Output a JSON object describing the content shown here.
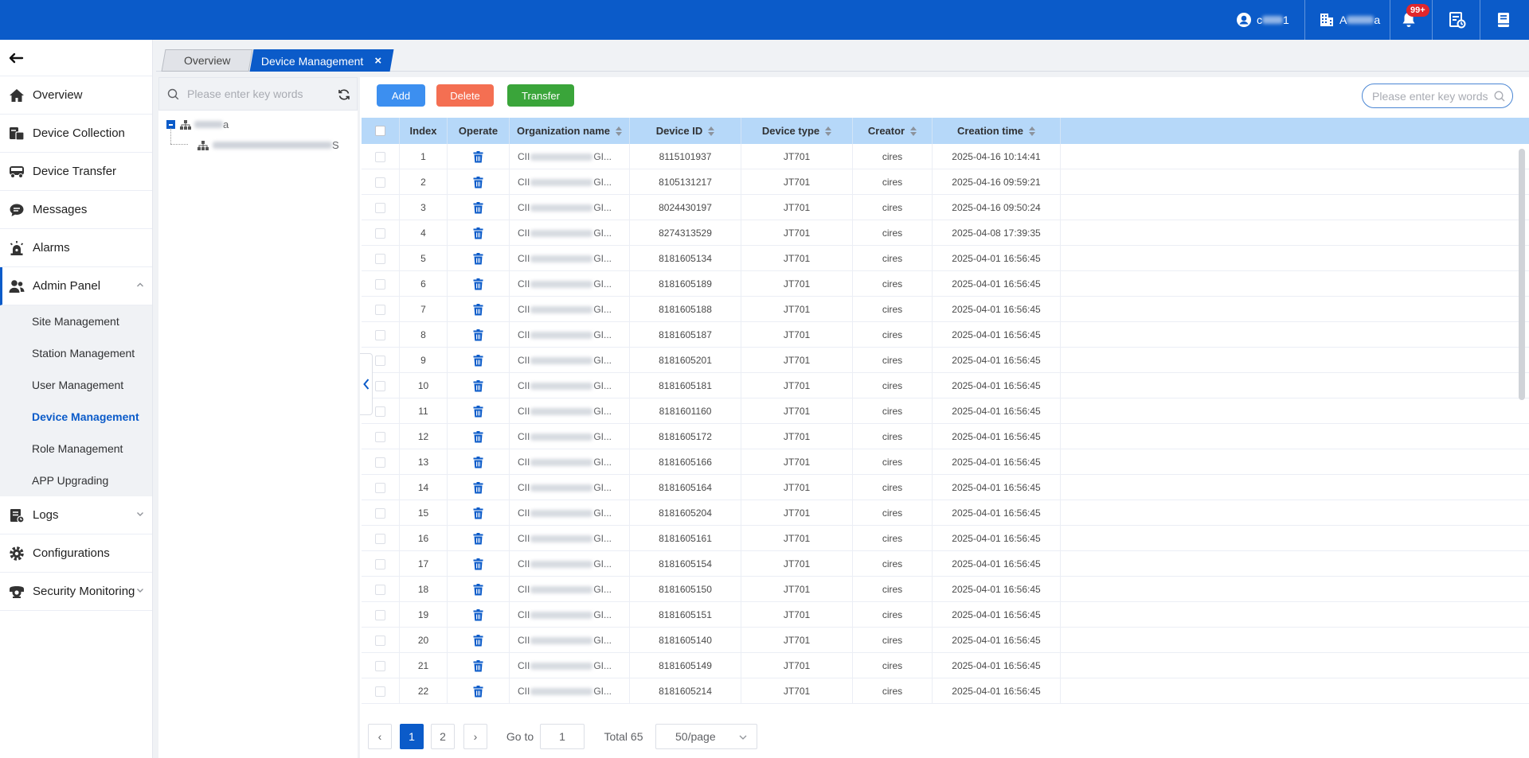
{
  "header": {
    "user_prefix": "c",
    "user_suffix": "1",
    "org_prefix": "A",
    "org_suffix": "a",
    "notification_badge": "99+",
    "icons": [
      "user-circle-icon",
      "building-icon",
      "bell-icon",
      "report-icon",
      "book-icon"
    ]
  },
  "sidebar": {
    "items": [
      {
        "label": "Overview",
        "icon": "home-icon"
      },
      {
        "label": "Device Collection",
        "icon": "device-collection-icon"
      },
      {
        "label": "Device Transfer",
        "icon": "truck-icon"
      },
      {
        "label": "Messages",
        "icon": "chat-icon"
      },
      {
        "label": "Alarms",
        "icon": "alarm-icon"
      },
      {
        "label": "Admin Panel",
        "icon": "users-icon"
      },
      {
        "label": "Logs",
        "icon": "logs-icon"
      },
      {
        "label": "Configurations",
        "icon": "gear-icon"
      },
      {
        "label": "Security Monitoring",
        "icon": "camera-icon"
      }
    ],
    "admin_sub": [
      {
        "label": "Site Management"
      },
      {
        "label": "Station Management"
      },
      {
        "label": "User Management"
      },
      {
        "label": "Device Management"
      },
      {
        "label": "Role Management"
      },
      {
        "label": "APP Upgrading"
      }
    ]
  },
  "tabs": [
    {
      "label": "Overview"
    },
    {
      "label": "Device Management",
      "close": "×"
    }
  ],
  "tree": {
    "search_placeholder": "Please enter key words",
    "root_suffix": "a",
    "child_suffix": "S"
  },
  "toolbar": {
    "add": "Add",
    "delete": "Delete",
    "transfer": "Transfer",
    "search_placeholder": "Please enter key words"
  },
  "table": {
    "columns": [
      "Index",
      "Operate",
      "Organization name",
      "Device ID",
      "Device type",
      "Creator",
      "Creation time"
    ],
    "org_prefix": "CII",
    "org_suffix": "GI...",
    "rows": [
      {
        "index": "1",
        "device_id": "8115101937",
        "type": "JT701",
        "creator": "cires",
        "time": "2025-04-16 10:14:41"
      },
      {
        "index": "2",
        "device_id": "8105131217",
        "type": "JT701",
        "creator": "cires",
        "time": "2025-04-16 09:59:21"
      },
      {
        "index": "3",
        "device_id": "8024430197",
        "type": "JT701",
        "creator": "cires",
        "time": "2025-04-16 09:50:24"
      },
      {
        "index": "4",
        "device_id": "8274313529",
        "type": "JT701",
        "creator": "cires",
        "time": "2025-04-08 17:39:35"
      },
      {
        "index": "5",
        "device_id": "8181605134",
        "type": "JT701",
        "creator": "cires",
        "time": "2025-04-01 16:56:45"
      },
      {
        "index": "6",
        "device_id": "8181605189",
        "type": "JT701",
        "creator": "cires",
        "time": "2025-04-01 16:56:45"
      },
      {
        "index": "7",
        "device_id": "8181605188",
        "type": "JT701",
        "creator": "cires",
        "time": "2025-04-01 16:56:45"
      },
      {
        "index": "8",
        "device_id": "8181605187",
        "type": "JT701",
        "creator": "cires",
        "time": "2025-04-01 16:56:45"
      },
      {
        "index": "9",
        "device_id": "8181605201",
        "type": "JT701",
        "creator": "cires",
        "time": "2025-04-01 16:56:45"
      },
      {
        "index": "10",
        "device_id": "8181605181",
        "type": "JT701",
        "creator": "cires",
        "time": "2025-04-01 16:56:45"
      },
      {
        "index": "11",
        "device_id": "8181601160",
        "type": "JT701",
        "creator": "cires",
        "time": "2025-04-01 16:56:45"
      },
      {
        "index": "12",
        "device_id": "8181605172",
        "type": "JT701",
        "creator": "cires",
        "time": "2025-04-01 16:56:45"
      },
      {
        "index": "13",
        "device_id": "8181605166",
        "type": "JT701",
        "creator": "cires",
        "time": "2025-04-01 16:56:45"
      },
      {
        "index": "14",
        "device_id": "8181605164",
        "type": "JT701",
        "creator": "cires",
        "time": "2025-04-01 16:56:45"
      },
      {
        "index": "15",
        "device_id": "8181605204",
        "type": "JT701",
        "creator": "cires",
        "time": "2025-04-01 16:56:45"
      },
      {
        "index": "16",
        "device_id": "8181605161",
        "type": "JT701",
        "creator": "cires",
        "time": "2025-04-01 16:56:45"
      },
      {
        "index": "17",
        "device_id": "8181605154",
        "type": "JT701",
        "creator": "cires",
        "time": "2025-04-01 16:56:45"
      },
      {
        "index": "18",
        "device_id": "8181605150",
        "type": "JT701",
        "creator": "cires",
        "time": "2025-04-01 16:56:45"
      },
      {
        "index": "19",
        "device_id": "8181605151",
        "type": "JT701",
        "creator": "cires",
        "time": "2025-04-01 16:56:45"
      },
      {
        "index": "20",
        "device_id": "8181605140",
        "type": "JT701",
        "creator": "cires",
        "time": "2025-04-01 16:56:45"
      },
      {
        "index": "21",
        "device_id": "8181605149",
        "type": "JT701",
        "creator": "cires",
        "time": "2025-04-01 16:56:45"
      },
      {
        "index": "22",
        "device_id": "8181605214",
        "type": "JT701",
        "creator": "cires",
        "time": "2025-04-01 16:56:45"
      }
    ]
  },
  "pagination": {
    "prev": "‹",
    "pages": [
      "1",
      "2"
    ],
    "current": "1",
    "next": "›",
    "goto_label": "Go to",
    "goto_value": "1",
    "total": "Total 65",
    "page_size": "50/page"
  },
  "colors": {
    "primary": "#0b5bc9",
    "add": "#3c8ff0",
    "delete": "#f46f52",
    "transfer": "#3aa53a",
    "table_header": "#b6d8f9"
  }
}
